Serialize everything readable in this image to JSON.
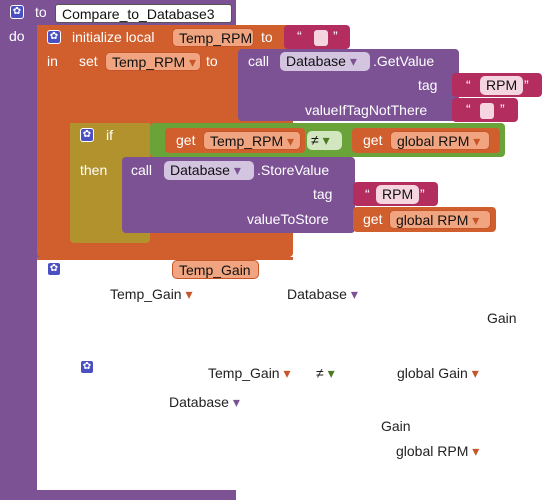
{
  "procedure": {
    "to_label": "to",
    "name": "Compare_to_Database3",
    "do_label": "do"
  },
  "init_local": {
    "label": "initialize local",
    "var_name": "Temp_RPM",
    "to_label": "to",
    "in_label": "in",
    "quote_open": "“",
    "quote_close": "”",
    "value": ""
  },
  "set_block": {
    "label": "set",
    "var_name": "Temp_RPM",
    "arrow": "▾",
    "to_label": "to"
  },
  "getvalue_call": {
    "call_label": "call",
    "component": "Database",
    "arrow": "▾",
    "method": ".GetValue",
    "tag_label": "tag",
    "tag_value": "RPM",
    "value_if_label": "valueIfTagNotThere",
    "value_if_value": ""
  },
  "if_block": {
    "if_label": "if",
    "then_label": "then",
    "get_label": "get",
    "left_var": "Temp_RPM",
    "operator": "≠",
    "right_var": "global RPM"
  },
  "storevalue_call": {
    "call_label": "call",
    "component": "Database",
    "method": ".StoreValue",
    "tag_label": "tag",
    "tag_value": "RPM",
    "value_label": "valueToStore",
    "get_label": "get",
    "value_var": "global RPM"
  },
  "second_block": {
    "var_name": "Temp_Gain",
    "temp_gain_dropdown": "Temp_Gain",
    "database_dropdown": "Database",
    "gain_text": "Gain",
    "compare_left": "Temp_Gain",
    "compare_op": "≠",
    "compare_right": "global Gain",
    "database_dropdown2": "Database",
    "gain_text2": "Gain",
    "global_rpm": "global RPM"
  },
  "colors": {
    "procedure": "#7c5295",
    "local_var": "#d05f2d",
    "control": "#b1922d",
    "logic": "#6aa33a",
    "text": "#b32d5e",
    "gear": "#4a4fc2"
  }
}
